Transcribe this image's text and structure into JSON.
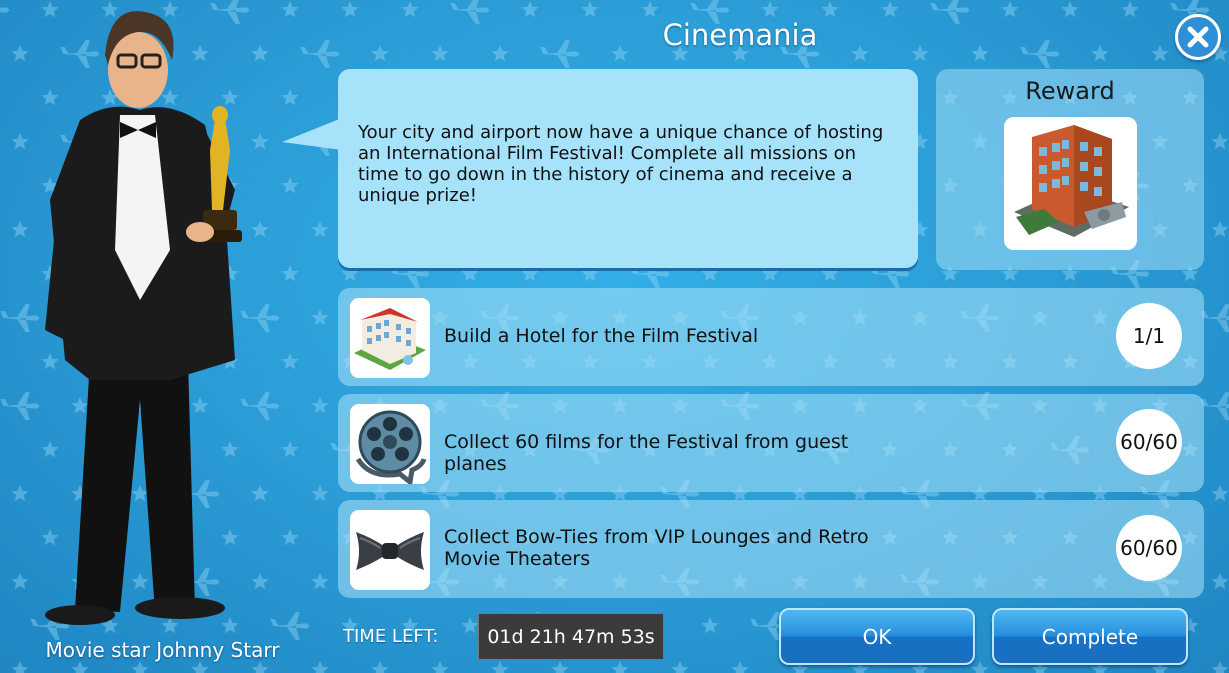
{
  "dialog": {
    "title": "Cinemania",
    "description": "Your city and airport now have a unique chance of hosting an International Film Festival! Complete all missions on time to go down in the history of cinema and receive a unique prize!",
    "character_name": "Movie star Johnny Starr"
  },
  "reward": {
    "label": "Reward",
    "icon": "hotel-building-icon"
  },
  "missions": [
    {
      "text": "Build a Hotel for the Film Festival",
      "progress": "1/1",
      "icon": "hotel-icon"
    },
    {
      "text": "Collect 60 films for the Festival from guest planes",
      "progress": "60/60",
      "icon": "film-reel-icon"
    },
    {
      "text": "Collect Bow-Ties from VIP Lounges and Retro Movie Theaters",
      "progress": "60/60",
      "icon": "bow-tie-icon"
    }
  ],
  "footer": {
    "time_label": "TIME LEFT:",
    "time_value": "01d 21h 47m 53s",
    "ok_label": "OK",
    "complete_label": "Complete"
  },
  "colors": {
    "background": "#2a9fd8",
    "speech_bubble": "#a7e2fb",
    "button": "#2590dd"
  }
}
